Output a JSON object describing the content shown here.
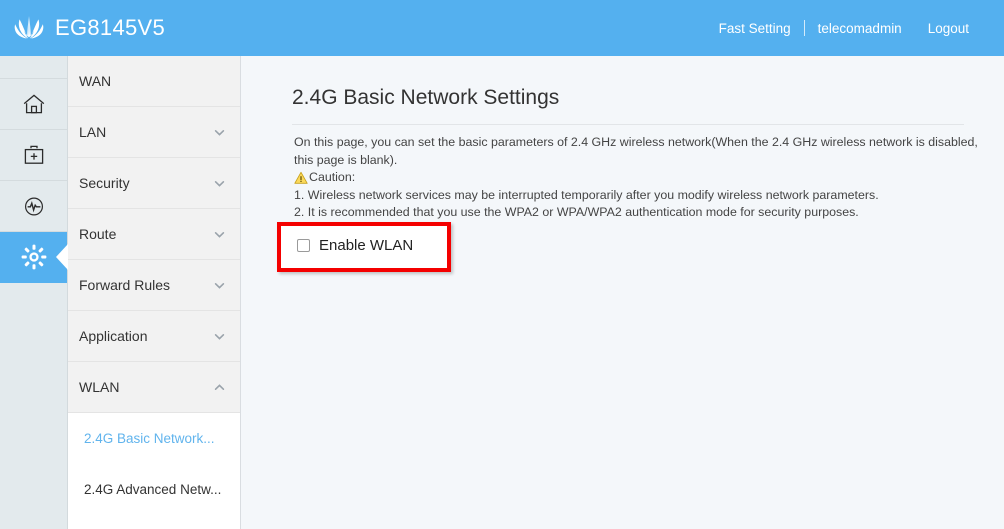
{
  "header": {
    "brand": "EG8145V5",
    "logo_icon": "huawei-flower-logo",
    "links": [
      {
        "label": "Fast Setting",
        "name": "fast-setting-link"
      },
      {
        "label": "telecomadmin",
        "name": "account-link"
      },
      {
        "label": "Logout",
        "name": "logout-link"
      }
    ]
  },
  "rail": {
    "items": [
      {
        "icon": "home-icon",
        "name": "rail-item-home",
        "active": false
      },
      {
        "icon": "toolbox-plus-icon",
        "name": "rail-item-diagnosis",
        "active": false
      },
      {
        "icon": "gauge-pulse-icon",
        "name": "rail-item-status",
        "active": false
      },
      {
        "icon": "gear-icon",
        "name": "rail-item-advanced",
        "active": true
      }
    ]
  },
  "sidebar": {
    "items": [
      {
        "label": "WAN",
        "expandable": false,
        "expanded": false
      },
      {
        "label": "LAN",
        "expandable": true,
        "expanded": false
      },
      {
        "label": "Security",
        "expandable": true,
        "expanded": false
      },
      {
        "label": "Route",
        "expandable": true,
        "expanded": false
      },
      {
        "label": "Forward Rules",
        "expandable": true,
        "expanded": false
      },
      {
        "label": "Application",
        "expandable": true,
        "expanded": false
      },
      {
        "label": "WLAN",
        "expandable": true,
        "expanded": true
      }
    ],
    "submenu": [
      {
        "label": "2.4G Basic Network...",
        "active": true
      },
      {
        "label": "2.4G Advanced Netw...",
        "active": false
      }
    ]
  },
  "main": {
    "title": "2.4G Basic Network Settings",
    "description_line1": "On this page, you can set the basic parameters of 2.4 GHz wireless network(When the 2.4 GHz wireless network is disabled, this page is blank).",
    "caution_label": "Caution:",
    "caution_icon": "warning-triangle-icon",
    "caution_items": [
      "1. Wireless network services may be interrupted temporarily after you modify wireless network parameters.",
      "2. It is recommended that you use the WPA2 or WPA/WPA2 authentication mode for security purposes."
    ],
    "enable_wlan_label": "Enable WLAN",
    "enable_wlan_checked": false
  },
  "colors": {
    "header_blue": "#54b0ef",
    "rail_bg": "#e3eaed",
    "menu_bg": "#f2f2f2",
    "content_bg": "#f4f7fa",
    "active_link": "#61b4ed",
    "highlight_red": "#f40000",
    "warning_yellow": "#f2c230"
  }
}
